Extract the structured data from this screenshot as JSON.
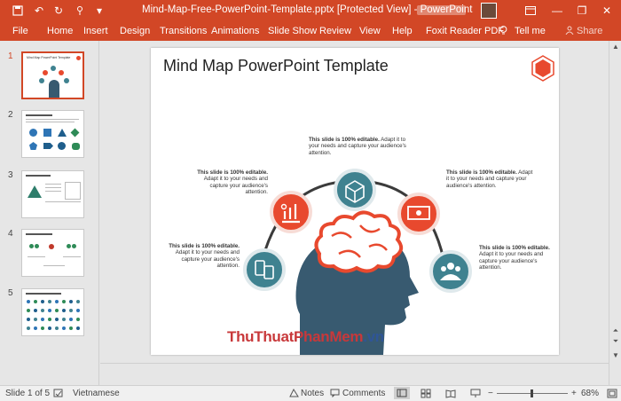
{
  "window": {
    "title": "Mind-Map-Free-PowerPoint-Template.pptx [Protected View]  -  PowerPoint",
    "minimize": "—",
    "restore": "❐",
    "close": "✕"
  },
  "quick_access": [
    "save-icon",
    "undo-icon",
    "redo-icon",
    "touch-mode-icon",
    "customize-icon"
  ],
  "ribbon": {
    "tabs": [
      "File",
      "Home",
      "Insert",
      "Design",
      "Transitions",
      "Animations",
      "Slide Show",
      "Review",
      "View",
      "Help",
      "Foxit Reader PDF"
    ],
    "tell_me": "Tell me",
    "share": "Share"
  },
  "thumbnails": {
    "numbers": [
      "1",
      "2",
      "3",
      "4",
      "5"
    ],
    "active": 1,
    "thumb1_title": "Mind Map PowerPoint Template"
  },
  "slide": {
    "title": "Mind Map PowerPoint Template",
    "captions": [
      {
        "bold": "This slide is 100% editable.",
        "rest": " Adapt it to your needs and capture your audience's attention."
      },
      {
        "bold": "This slide is 100% editable.",
        "rest": " Adapt it to your needs and capture your audience's attention."
      },
      {
        "bold": "This slide is 100% editable.",
        "rest": " Adapt it to your needs and capture your audience's attention."
      },
      {
        "bold": "This slide is 100% editable.",
        "rest": " Adapt it to your needs and capture your audience's attention."
      },
      {
        "bold": "This slide is 100% editable.",
        "rest": " Adapt it to your needs and capture your audience's attention."
      }
    ],
    "watermark_main": "ThuThuatPhanMem",
    "watermark_tld": ".vn"
  },
  "colors": {
    "accent": "#d24726",
    "teal": "#3f8290",
    "orange": "#e8492e",
    "head": "#385a70"
  },
  "status": {
    "slide_of": "Slide 1 of 5",
    "language": "Vietnamese",
    "notes": "Notes",
    "comments": "Comments",
    "zoom": "68%"
  }
}
